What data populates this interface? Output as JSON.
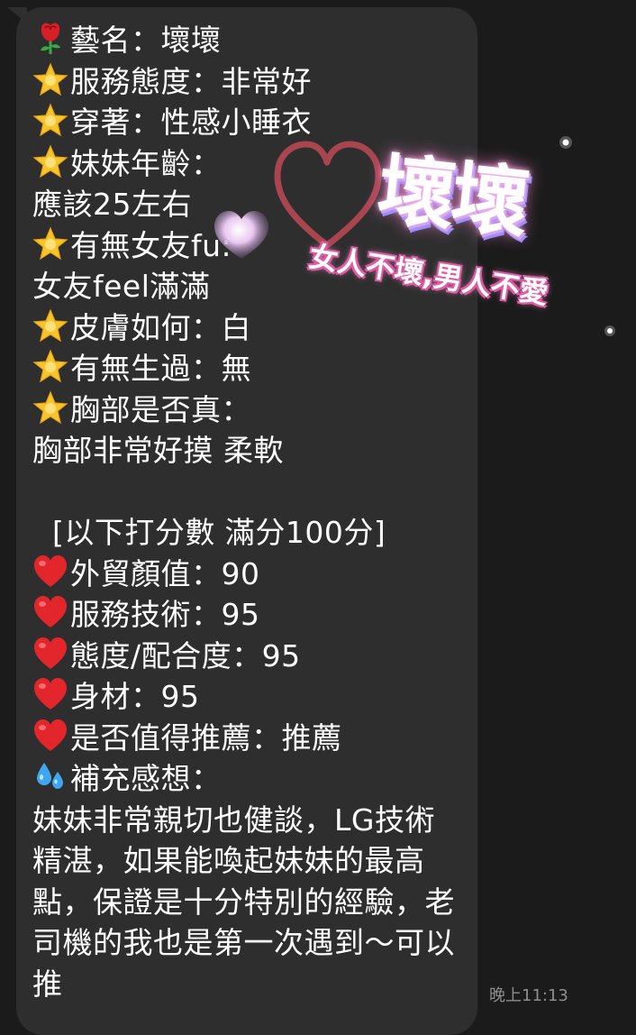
{
  "message": {
    "lines": [
      {
        "icon": "rose-icon",
        "text": "藝名：壞壞"
      },
      {
        "icon": "star-icon",
        "text": "服務態度：非常好"
      },
      {
        "icon": "star-icon",
        "text": "穿著：性感小睡衣"
      },
      {
        "icon": "star-icon",
        "text": "妹妹年齡："
      },
      {
        "icon": "",
        "text": "應該25左右"
      },
      {
        "icon": "star-icon",
        "text": "有無女友fu:"
      },
      {
        "icon": "",
        "text": "女友feel滿滿"
      },
      {
        "icon": "star-icon",
        "text": "皮膚如何：白"
      },
      {
        "icon": "star-icon",
        "text": "有無生過：無"
      },
      {
        "icon": "star-icon",
        "text": "胸部是否真："
      },
      {
        "icon": "",
        "text": "胸部非常好摸 柔軟"
      },
      {
        "icon": "",
        "text": ""
      },
      {
        "icon": "",
        "text": "  [以下打分數 滿分100分]"
      },
      {
        "icon": "heart-icon",
        "text": "外貿顏值：90"
      },
      {
        "icon": "heart-icon",
        "text": "服務技術：95"
      },
      {
        "icon": "heart-icon",
        "text": "態度/配合度：95"
      },
      {
        "icon": "heart-icon",
        "text": "身材：95"
      },
      {
        "icon": "heart-icon",
        "text": "是否值得推薦：推薦"
      },
      {
        "icon": "sweat-drops-icon",
        "text": "補充感想："
      }
    ],
    "comment": "妹妹非常親切也健談，LG技術精湛，如果能喚起妹妹的最高點，保證是十分特別的經驗，老司機的我也是第一次遇到～可以推"
  },
  "sticker": {
    "title": "壞壞",
    "subtitle": "女人不壞,男人不愛"
  },
  "timestamp": "晚上11:13",
  "colors": {
    "background": "#1b1b1b",
    "bubble": "#2e2e2e",
    "text": "#ffffff",
    "timestamp": "#8e8e8e",
    "heart": "#e3262c",
    "star": "#f7c42a",
    "sticker_accent": "#e25aa5"
  }
}
